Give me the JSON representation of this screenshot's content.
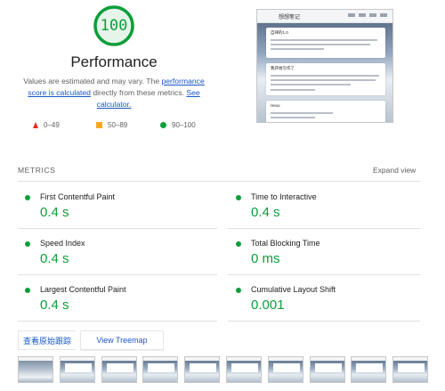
{
  "gauge": {
    "score": "100",
    "score_fraction": 1.0,
    "color": "#0c9e3a"
  },
  "performance": {
    "title": "Performance",
    "desc_part1": "Values are estimated and may vary. The ",
    "desc_link1": "performance score is calculated",
    "desc_part2": " directly from these metrics. ",
    "desc_link2": "See calculator."
  },
  "legend": {
    "fail": "0–49",
    "average": "50–89",
    "pass": "90–100",
    "fail_color": "#e8281f",
    "average_color": "#f9a825",
    "pass_color": "#0c9e3a"
  },
  "thumbnail": {
    "site_name": "想想笔记",
    "card1_title": "自律的1.0",
    "card2_title": "我开始写作了",
    "card3_title": "Hexo"
  },
  "metrics": {
    "heading": "METRICS",
    "expand_label": "Expand view",
    "items": [
      {
        "label": "First Contentful Paint",
        "value": "0.4 s"
      },
      {
        "label": "Time to Interactive",
        "value": "0.4 s"
      },
      {
        "label": "Speed Index",
        "value": "0.4 s"
      },
      {
        "label": "Total Blocking Time",
        "value": "0 ms"
      },
      {
        "label": "Largest Contentful Paint",
        "value": "0.4 s"
      },
      {
        "label": "Cumulative Layout Shift",
        "value": "0.001"
      }
    ]
  },
  "buttons": {
    "trace_label": "查看原始跟踪",
    "treemap_label": "View Treemap"
  },
  "filmstrip": {
    "frame_count": 10
  }
}
